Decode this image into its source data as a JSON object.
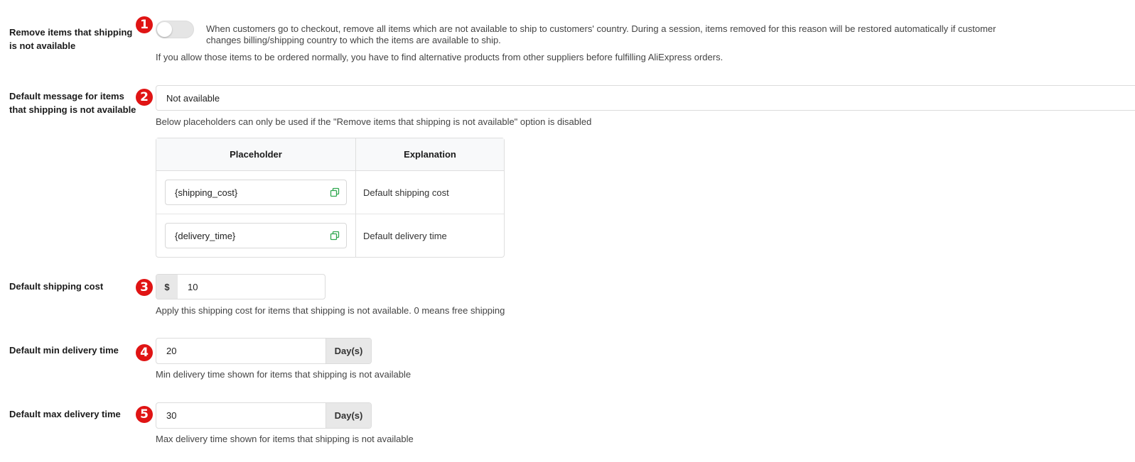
{
  "fields": {
    "remove_items": {
      "label_line1": "Remove items that shipping",
      "label_line2": "is not available",
      "badge": "1",
      "toggle_state": "off",
      "desc_line1": "When customers go to checkout, remove all items which are not available to ship to customers' country. During a session, items removed for this reason will be restored automatically if customer",
      "desc_line2": "changes billing/shipping country to which the items are available to ship.",
      "note": "If you allow those items to be ordered normally, you have to find alternative products from other suppliers before fulfilling AliExpress orders."
    },
    "default_message": {
      "label_line1": "Default message for items",
      "label_line2": "that shipping is not available",
      "badge": "2",
      "value": "Not available",
      "note": "Below placeholders can only be used if the \"Remove items that shipping is not available\" option is disabled"
    },
    "placeholders_table": {
      "headers": [
        "Placeholder",
        "Explanation"
      ],
      "rows": [
        {
          "placeholder": "{shipping_cost}",
          "explanation": "Default shipping cost"
        },
        {
          "placeholder": "{delivery_time}",
          "explanation": "Default delivery time"
        }
      ]
    },
    "shipping_cost": {
      "label": "Default shipping cost",
      "badge": "3",
      "prefix": "$",
      "value": "10",
      "note": "Apply this shipping cost for items that shipping is not available. 0 means free shipping"
    },
    "min_delivery": {
      "label": "Default min delivery time",
      "badge": "4",
      "value": "20",
      "suffix": "Day(s)",
      "note": "Min delivery time shown for items that shipping is not available"
    },
    "max_delivery": {
      "label": "Default max delivery time",
      "badge": "5",
      "value": "30",
      "suffix": "Day(s)",
      "note": "Max delivery time shown for items that shipping is not available"
    }
  },
  "colors": {
    "badge": "#e01414",
    "copy_icon": "#2fa84f",
    "addon_bg": "#e8e8e8"
  }
}
